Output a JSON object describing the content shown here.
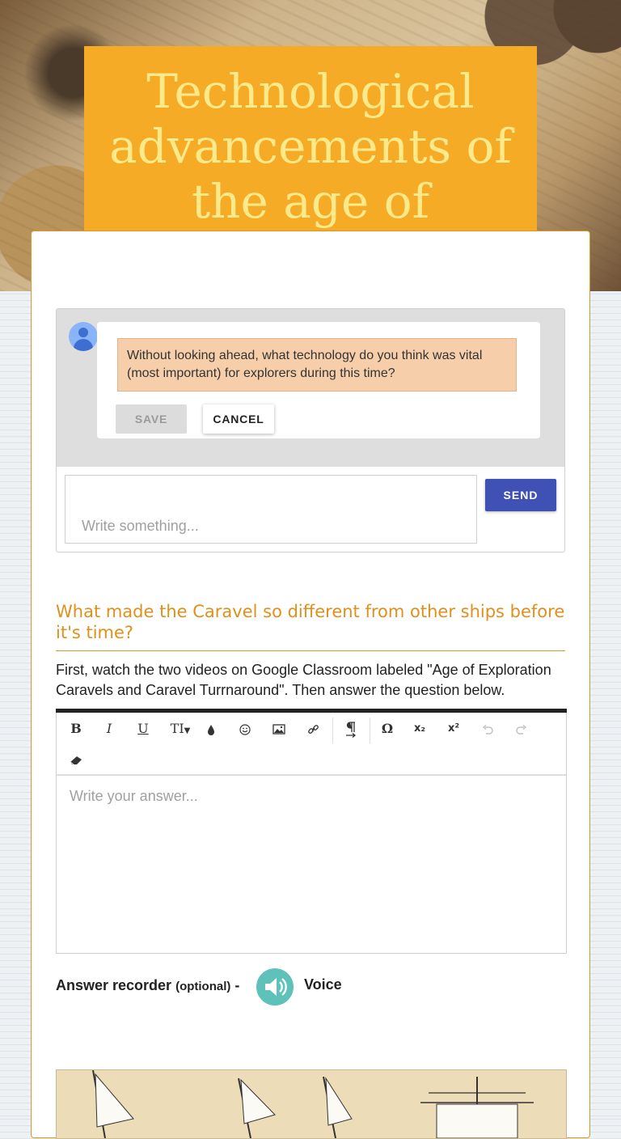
{
  "header": {
    "title": "Technological advancements of the age of exploration"
  },
  "comment": {
    "prompt": "Without looking ahead, what technology do you think was vital (most important) for explorers during this time?",
    "save_label": "SAVE",
    "cancel_label": "CANCEL",
    "reply_placeholder": "Write something...",
    "send_label": "SEND"
  },
  "question": {
    "title": "What made the Caravel so different from other ships before it's time?",
    "description": "First, watch the two videos on Google Classroom labeled \"Age of Exploration Caravels and Caravel Turrnaround\". Then answer the question below.",
    "answer_placeholder": "Write your answer..."
  },
  "toolbar": {
    "bold": "B",
    "italic": "I",
    "underline": "U",
    "font_size": "TI",
    "special_char": "Ω",
    "subscript": "x₂",
    "superscript": "x²"
  },
  "recorder": {
    "label": "Answer recorder",
    "optional": "(optional)",
    "dash": "-",
    "voice_label": "Voice"
  },
  "colors": {
    "title_bg": "#f5ab26",
    "title_text": "#fbe98a",
    "question_title": "#e0901c",
    "send_button": "#3f51b5",
    "prompt_bg": "#f6cfaa",
    "voice_button": "#5ec2bb"
  }
}
